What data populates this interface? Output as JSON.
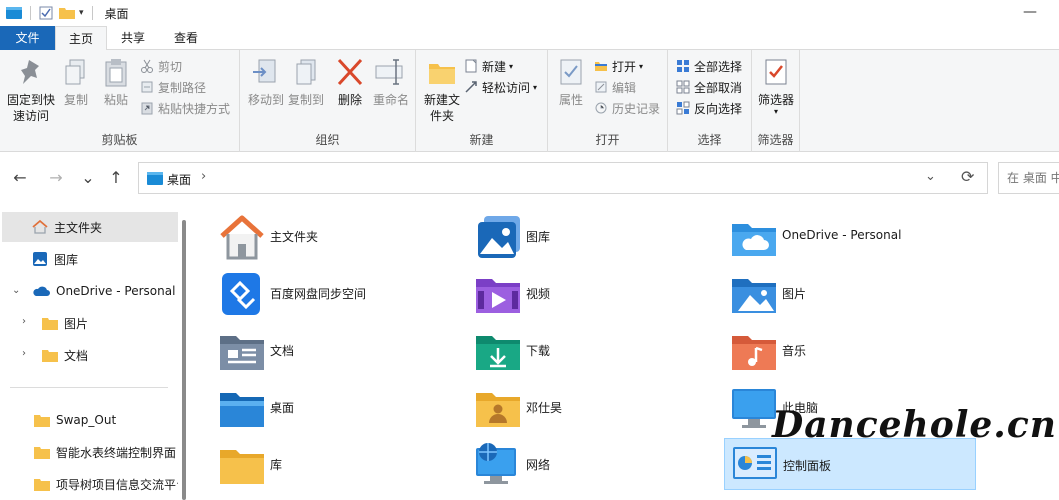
{
  "window": {
    "title": "桌面",
    "minimize_glyph": "—"
  },
  "tabs": [
    {
      "label": "文件"
    },
    {
      "label": "主页"
    },
    {
      "label": "共享"
    },
    {
      "label": "查看"
    }
  ],
  "ribbon": {
    "clipboard": {
      "label": "剪贴板",
      "pin": "固定到快速访问",
      "copy": "复制",
      "paste": "粘贴",
      "cut": "剪切",
      "copy_path": "复制路径",
      "paste_shortcut": "粘贴快捷方式"
    },
    "organize": {
      "label": "组织",
      "move_to": "移动到",
      "copy_to": "复制到",
      "delete": "删除",
      "rename": "重命名"
    },
    "new": {
      "label": "新建",
      "new_folder": "新建文件夹",
      "new_item": "新建",
      "easy_access": "轻松访问"
    },
    "open": {
      "label": "打开",
      "properties": "属性",
      "open": "打开",
      "edit": "编辑",
      "history": "历史记录"
    },
    "select": {
      "label": "选择",
      "select_all": "全部选择",
      "select_none": "全部取消",
      "invert": "反向选择"
    },
    "filter": {
      "label": "筛选器",
      "filter_btn": "筛选器"
    }
  },
  "nav": {
    "back": "←",
    "forward": "→",
    "recent": "⌄",
    "up": "↑",
    "address": "桌面",
    "address_chevron": "›",
    "dropdown": "⌄",
    "refresh": "⟳",
    "search_placeholder": "在 桌面 中搜索"
  },
  "sidebar": {
    "items": [
      {
        "label": "主文件夹"
      },
      {
        "label": "图库"
      },
      {
        "label": "OneDrive - Personal"
      },
      {
        "label": "图片"
      },
      {
        "label": "文档"
      },
      {
        "label": "Swap_Out"
      },
      {
        "label": "智能水表终端控制界面"
      },
      {
        "label": "项导树项目信息交流平台"
      }
    ]
  },
  "content": {
    "items": [
      {
        "label": "主文件夹",
        "icon": "home-icon"
      },
      {
        "label": "图库",
        "icon": "gallery-icon"
      },
      {
        "label": "OneDrive - Personal",
        "icon": "onedrive-folder-icon"
      },
      {
        "label": "百度网盘同步空间",
        "icon": "baidu-netdisk-icon"
      },
      {
        "label": "视频",
        "icon": "videos-folder-icon"
      },
      {
        "label": "图片",
        "icon": "pictures-folder-icon"
      },
      {
        "label": "文档",
        "icon": "documents-folder-icon"
      },
      {
        "label": "下载",
        "icon": "downloads-folder-icon"
      },
      {
        "label": "音乐",
        "icon": "music-folder-icon"
      },
      {
        "label": "桌面",
        "icon": "desktop-folder-icon"
      },
      {
        "label": "邓仕昊",
        "icon": "user-folder-icon"
      },
      {
        "label": "此电脑",
        "icon": "this-pc-icon"
      },
      {
        "label": "库",
        "icon": "library-folder-icon"
      },
      {
        "label": "网络",
        "icon": "network-icon"
      },
      {
        "label": "控制面板",
        "icon": "control-panel-icon"
      }
    ]
  },
  "watermark": "Dancehole.cn",
  "colors": {
    "accent": "#1a68b8",
    "selection": "#cce8ff",
    "folder_yellow": "#f6c14b",
    "ribbon_bg": "#f5f6f7"
  }
}
